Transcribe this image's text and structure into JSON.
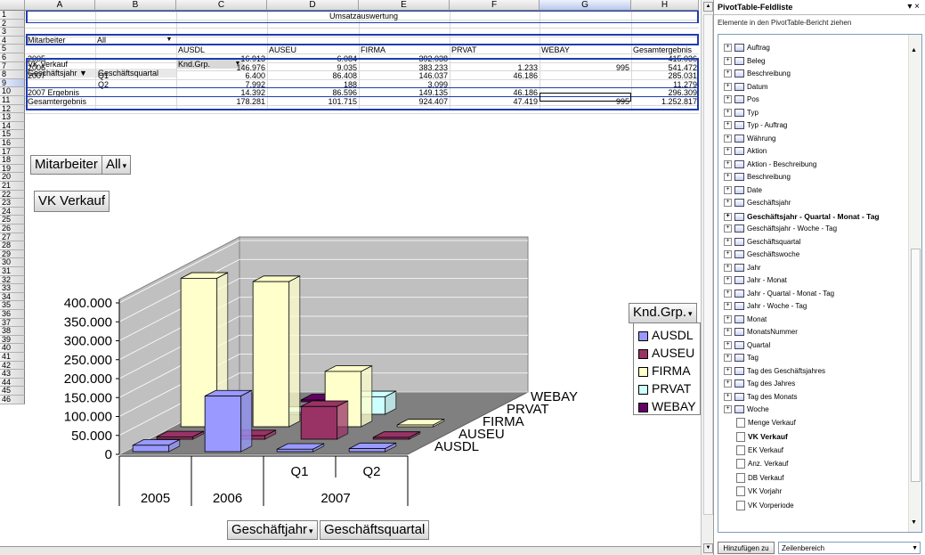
{
  "sheet": {
    "columns": [
      "A",
      "B",
      "C",
      "D",
      "E",
      "F",
      "G",
      "H"
    ],
    "rows": [
      "1",
      "2",
      "3",
      "4",
      "5",
      "6",
      "7",
      "8",
      "9",
      "10",
      "11",
      "12",
      "13",
      "14",
      "15",
      "16",
      "17",
      "18",
      "19",
      "20",
      "21",
      "22",
      "23",
      "24",
      "25",
      "26",
      "27",
      "28",
      "29",
      "30",
      "31",
      "32",
      "33",
      "34",
      "35",
      "36",
      "37",
      "38",
      "39",
      "40",
      "41",
      "42",
      "43",
      "44",
      "45",
      "46"
    ],
    "title": "Umsatzauswertung",
    "page_field_label": "Mitarbeiter",
    "page_field_value": "All",
    "data_field": "VK Verkauf",
    "col_field": "Knd.Grp.",
    "row_field1": "Geschäftsjahr",
    "row_field2": "Geschäftsquartal",
    "col_headers": [
      "AUSDL",
      "AUSEU",
      "FIRMA",
      "PRVAT",
      "WEBAY",
      "Gesamtergebnis"
    ],
    "table_rows": [
      {
        "a": "2005",
        "b": "",
        "vals": [
          "16.913",
          "6.084",
          "392.038",
          "",
          "",
          "415.036"
        ]
      },
      {
        "a": "2006",
        "b": "",
        "vals": [
          "146.976",
          "9.035",
          "383.233",
          "1.233",
          "995",
          "541.472"
        ]
      },
      {
        "a": "2007",
        "b": "Q1",
        "vals": [
          "6.400",
          "86.408",
          "146.037",
          "46.186",
          "",
          "285.031"
        ]
      },
      {
        "a": "",
        "b": "Q2",
        "vals": [
          "7.992",
          "188",
          "3.099",
          "",
          "",
          "11.279"
        ]
      },
      {
        "a": "2007 Ergebnis",
        "b": "",
        "vals": [
          "14.392",
          "86.596",
          "149.135",
          "46.186",
          "",
          "296.309"
        ]
      },
      {
        "a": "Gesamtergebnis",
        "b": "",
        "vals": [
          "178.281",
          "101.715",
          "924.407",
          "47.419",
          "995",
          "1.252.817"
        ]
      }
    ]
  },
  "chart": {
    "page_button": "Mitarbeiter",
    "page_value": "All",
    "data_button": "VK Verkauf",
    "legend_button": "Knd.Grp.",
    "axis_button1": "Geschäftjahr",
    "axis_button2": "Geschäftsquartal",
    "y_ticks": [
      "0",
      "50.000",
      "100.000",
      "150.000",
      "200.000",
      "250.000",
      "300.000",
      "350.000",
      "400.000"
    ],
    "depth_labels": [
      "AUSDL",
      "AUSEU",
      "FIRMA",
      "PRVAT",
      "WEBAY"
    ],
    "x_outer": [
      "2005",
      "2006",
      "2007"
    ],
    "x_inner": [
      "Q1",
      "Q2"
    ],
    "colors": {
      "AUSDL": "#9999ff",
      "AUSEU": "#993366",
      "FIRMA": "#ffffcc",
      "PRVAT": "#ccffff",
      "WEBAY": "#660066"
    }
  },
  "chart_data": {
    "type": "bar",
    "categories": [
      "2005",
      "2006",
      "2007 Q1",
      "2007 Q2"
    ],
    "series": [
      {
        "name": "AUSDL",
        "values": [
          16913,
          146976,
          6400,
          7992
        ]
      },
      {
        "name": "AUSEU",
        "values": [
          6084,
          9035,
          86408,
          188
        ]
      },
      {
        "name": "FIRMA",
        "values": [
          392038,
          383233,
          146037,
          3099
        ]
      },
      {
        "name": "PRVAT",
        "values": [
          0,
          1233,
          46186,
          0
        ]
      },
      {
        "name": "WEBAY",
        "values": [
          0,
          995,
          0,
          0
        ]
      }
    ],
    "ylim": [
      0,
      400000
    ],
    "legend": "right"
  },
  "panel": {
    "title": "PivotTable-Feldliste",
    "close": "▾ ×",
    "subtitle": "Elemente in den PivotTable-Bericht ziehen",
    "dims": [
      "Auftrag",
      "Beleg",
      "Beschreibung",
      "Datum",
      "Pos",
      "Typ",
      "Typ - Auftrag",
      "Währung",
      "Aktion",
      "Aktion - Beschreibung",
      "Beschreibung",
      "Date",
      "Geschäftsjahr",
      "Geschäftsjahr - Quartal - Monat - Tag",
      "Geschäftsjahr - Woche - Tag",
      "Geschäftsquartal",
      "Geschäftswoche",
      "Jahr",
      "Jahr - Monat",
      "Jahr - Quartal - Monat - Tag",
      "Jahr - Woche - Tag",
      "Monat",
      "MonatsNummer",
      "Quartal",
      "Tag",
      "Tag des Geschäftsjahres",
      "Tag des Jahres",
      "Tag des Monats",
      "Woche"
    ],
    "bold_dim": "Geschäftsjahr - Quartal - Monat - Tag",
    "measures": [
      "Menge Verkauf",
      "VK Verkauf",
      "EK Verkauf",
      "Anz. Verkauf",
      "DB Verkauf",
      "VK Vorjahr",
      "VK Vorperiode"
    ],
    "bold_measure": "VK Verkauf",
    "add_button": "Hinzufügen zu",
    "area_select": "Zeilenbereich"
  }
}
